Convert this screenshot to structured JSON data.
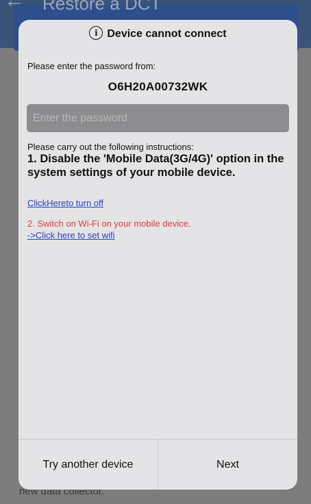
{
  "background": {
    "back_glyph": "←",
    "title": "Restore a DCT",
    "footer_text": "new data collector."
  },
  "dialog": {
    "title": "Device cannot connect",
    "info_glyph": "i",
    "password_prompt": "Please enter the password from:",
    "device_id": "O6H20A00732WK",
    "password_input": {
      "placeholder": "Enter the password",
      "value": ""
    },
    "instructions_intro": "Please carry out the following instructions:",
    "step1": "1. Disable the 'Mobile Data(3G/4G)' option in the system settings of your mobile device.",
    "step1_link": "ClickHereto turn off",
    "step2": "2. Switch on Wi-Fi on your mobile device.",
    "step2_link": "->Click here to set wifi",
    "buttons": {
      "secondary": "Try another device",
      "primary": "Next"
    }
  },
  "colors": {
    "link": "#2a3fc4",
    "warning": "#e23b3b",
    "dialog_bg": "#e4e4e6",
    "input_bg": "#8d8d8f"
  }
}
